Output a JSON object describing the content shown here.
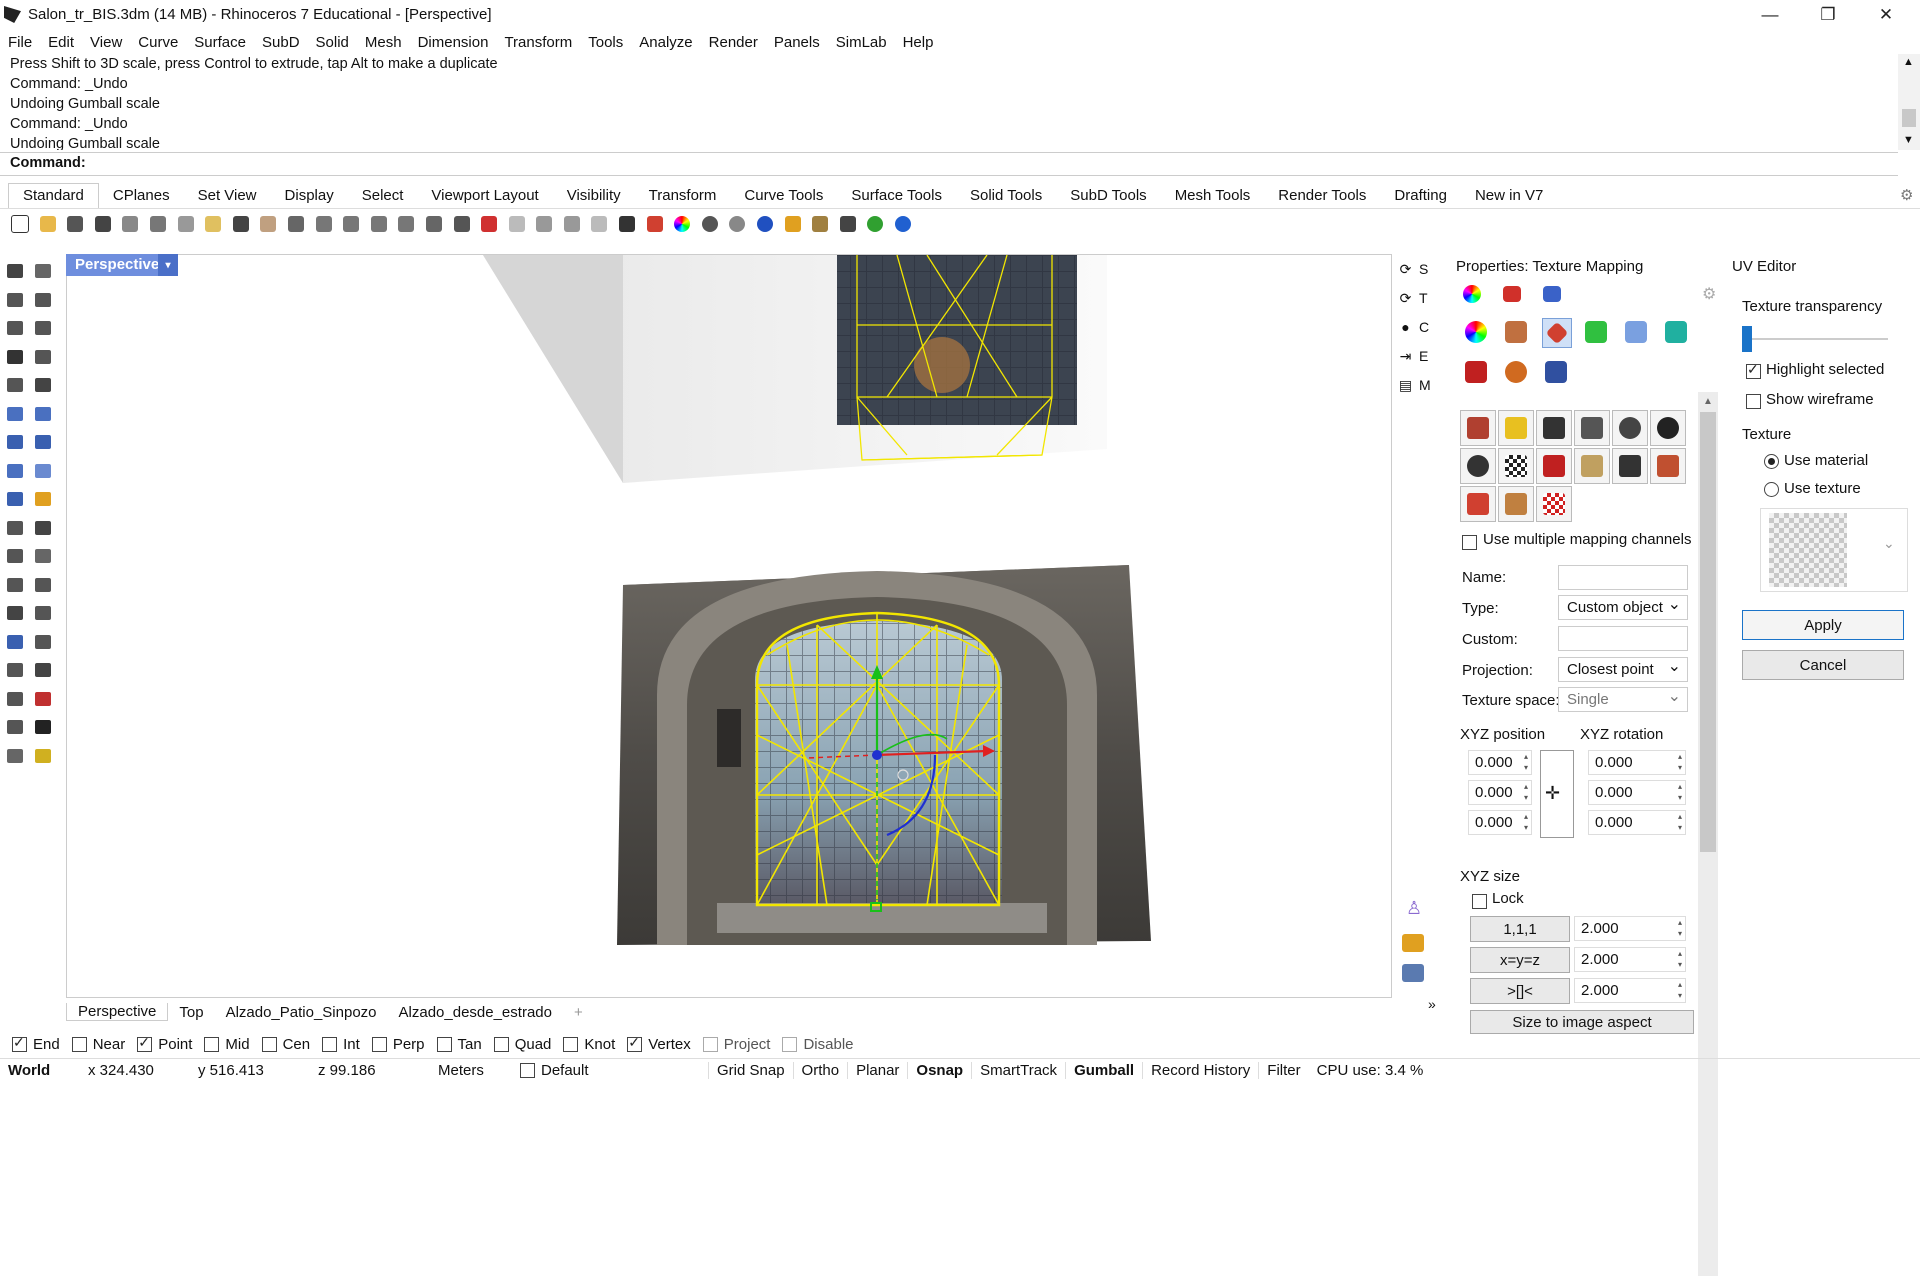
{
  "window": {
    "title": "Salon_tr_BIS.3dm (14 MB) - Rhinoceros 7 Educational - [Perspective]",
    "controls": [
      "—",
      "❐",
      "✕"
    ]
  },
  "menu": [
    "File",
    "Edit",
    "View",
    "Curve",
    "Surface",
    "SubD",
    "Solid",
    "Mesh",
    "Dimension",
    "Transform",
    "Tools",
    "Analyze",
    "Render",
    "Panels",
    "SimLab",
    "Help"
  ],
  "command_history": [
    "Press Shift to 3D scale, press Control to extrude, tap Alt to make a duplicate",
    "Command: _Undo",
    "Undoing Gumball scale",
    "Command: _Undo",
    "Undoing Gumball scale"
  ],
  "command_prompt": {
    "label": "Command:",
    "value": ""
  },
  "toolbar_tabs": [
    "Standard",
    "CPlanes",
    "Set View",
    "Display",
    "Select",
    "Viewport Layout",
    "Visibility",
    "Transform",
    "Curve Tools",
    "Surface Tools",
    "Solid Tools",
    "SubD Tools",
    "Mesh Tools",
    "Render Tools",
    "Drafting",
    "New in V7"
  ],
  "active_tab": "Standard",
  "viewport": {
    "label": "Perspective",
    "dropdown_icon": "▾"
  },
  "viewport_tabs": [
    "Perspective",
    "Top",
    "Alzado_Patio_Sinpozo",
    "Alzado_desde_estrado",
    "+"
  ],
  "side_panel": [
    {
      "icon": "⟳",
      "label": "S"
    },
    {
      "icon": "⟳",
      "label": "T"
    },
    {
      "icon": "●",
      "label": "C"
    },
    {
      "icon": "⇥",
      "label": "E"
    },
    {
      "icon": "▤",
      "label": "M"
    }
  ],
  "properties": {
    "title": "Properties: Texture Mapping",
    "use_multiple_channels_label": "Use multiple mapping channels",
    "use_multiple_channels": false,
    "name_label": "Name:",
    "name_value": "",
    "type_label": "Type:",
    "type_value": "Custom object",
    "custom_label": "Custom:",
    "custom_value": "",
    "projection_label": "Projection:",
    "projection_value": "Closest point",
    "texture_space_label": "Texture space:",
    "texture_space_value": "Single",
    "xyz_position_label": "XYZ position",
    "xyz_rotation_label": "XYZ rotation",
    "position": [
      "0.000",
      "0.000",
      "0.000"
    ],
    "rotation": [
      "0.000",
      "0.000",
      "0.000"
    ],
    "xyz_size_label": "XYZ size",
    "lock_label": "Lock",
    "lock": false,
    "size_buttons": [
      "1,1,1",
      "x=y=z",
      ">[]<"
    ],
    "size": [
      "2.000",
      "2.000",
      "2.000"
    ],
    "size_to_image_label": "Size to image aspect"
  },
  "uv_editor": {
    "title": "UV Editor",
    "transparency_label": "Texture transparency",
    "transparency": 0.0,
    "highlight_selected_label": "Highlight selected",
    "highlight_selected": true,
    "show_wireframe_label": "Show wireframe",
    "show_wireframe": false,
    "texture_label": "Texture",
    "use_material_label": "Use material",
    "use_texture_label": "Use texture",
    "texture_choice": "Use material",
    "apply_label": "Apply",
    "cancel_label": "Cancel"
  },
  "osnaps": [
    {
      "label": "End",
      "checked": true
    },
    {
      "label": "Near",
      "checked": false
    },
    {
      "label": "Point",
      "checked": true
    },
    {
      "label": "Mid",
      "checked": false
    },
    {
      "label": "Cen",
      "checked": false
    },
    {
      "label": "Int",
      "checked": false
    },
    {
      "label": "Perp",
      "checked": false
    },
    {
      "label": "Tan",
      "checked": false
    },
    {
      "label": "Quad",
      "checked": false
    },
    {
      "label": "Knot",
      "checked": false
    },
    {
      "label": "Vertex",
      "checked": true
    },
    {
      "label": "Project",
      "checked": false
    },
    {
      "label": "Disable",
      "checked": false
    }
  ],
  "status": {
    "cplane": "World",
    "x": "x 324.430",
    "y": "y 516.413",
    "z": "z 99.186",
    "units": "Meters",
    "layer": "Default",
    "toggles": [
      "Grid Snap",
      "Ortho",
      "Planar",
      "Osnap",
      "SmartTrack",
      "Gumball",
      "Record History",
      "Filter"
    ],
    "bold_toggles": [
      "Osnap",
      "Gumball"
    ],
    "cpu": "CPU use: 3.4 %"
  },
  "colors": {
    "viewport_label_bg": "#6e8ede",
    "wireframe_yellow": "#f2e600",
    "accent_blue": "#1a73c8"
  }
}
